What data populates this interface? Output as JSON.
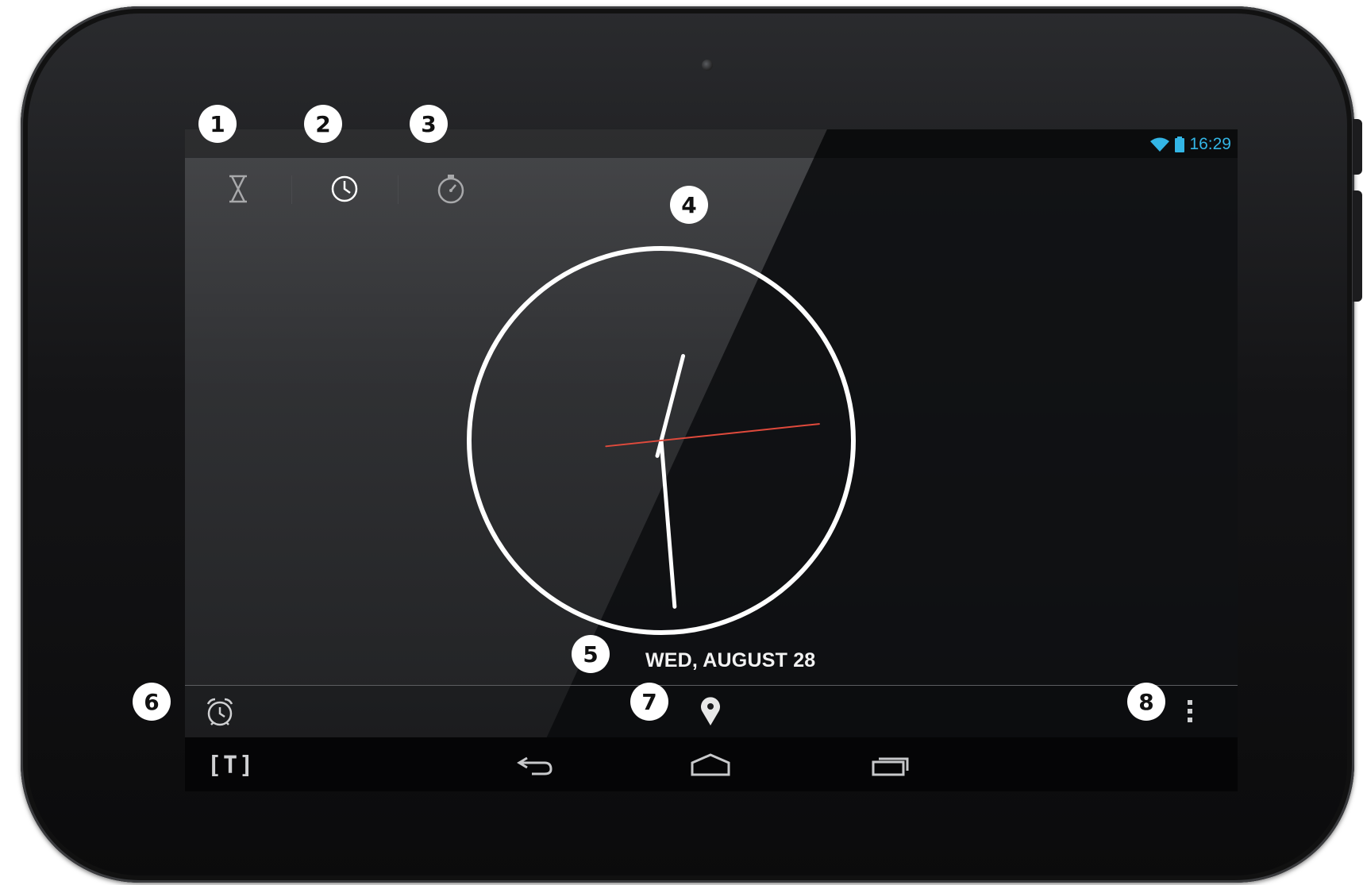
{
  "status_bar": {
    "time": "16:29",
    "wifi_icon": "wifi-icon",
    "battery_icon": "battery-icon"
  },
  "tabs": [
    {
      "id": "timer",
      "icon": "hourglass-icon"
    },
    {
      "id": "clock",
      "icon": "clock-icon",
      "selected": true
    },
    {
      "id": "stopwatch",
      "icon": "stopwatch-icon"
    }
  ],
  "clock": {
    "hours": 12,
    "minutes": 29,
    "seconds": 14,
    "date": "WED, AUGUST 28"
  },
  "bottom_bar": {
    "left_icon": "alarm-clock-icon",
    "center_icon": "location-pin-icon",
    "right_icon": "overflow-menu-icon"
  },
  "nav_bar": {
    "logo": "[T]",
    "buttons": [
      "back-icon",
      "home-icon",
      "recent-apps-icon"
    ]
  },
  "callouts": [
    "1",
    "2",
    "3",
    "4",
    "5",
    "6",
    "7",
    "8"
  ],
  "colors": {
    "accent": "#33b5e5",
    "second_hand": "#e04a3c",
    "background": "#1a1b1d"
  }
}
